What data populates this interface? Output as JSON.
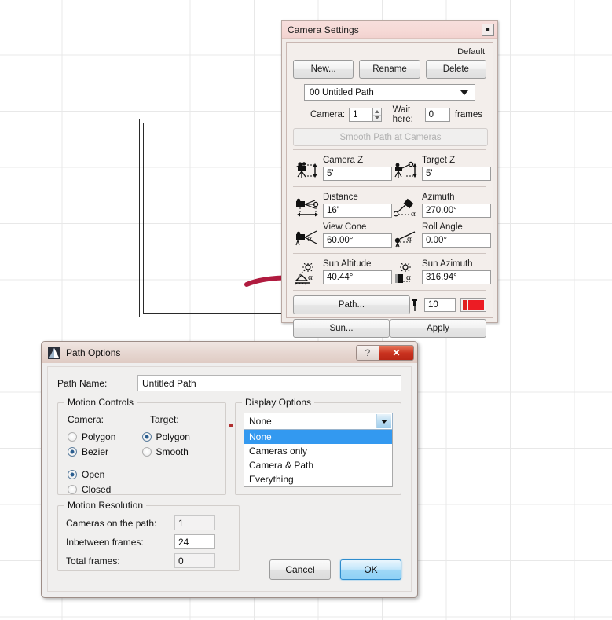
{
  "camera_settings": {
    "title": "Camera Settings",
    "close_icon": "close-icon",
    "default_label": "Default",
    "buttons": {
      "new": "New...",
      "rename": "Rename",
      "delete": "Delete"
    },
    "path_combo_value": "00  Untitled Path",
    "camera_label": "Camera:",
    "camera_value": "1",
    "wait_label": "Wait here:",
    "wait_value": "0",
    "frames_label": "frames",
    "smooth_button": "Smooth Path at Cameras",
    "fields": [
      {
        "label": "Camera Z",
        "value": "5'",
        "icon": "camera-height-icon"
      },
      {
        "label": "Target Z",
        "value": "5'",
        "icon": "target-height-icon"
      },
      {
        "label": "Distance",
        "value": "16'",
        "icon": "camera-distance-icon"
      },
      {
        "label": "Azimuth",
        "value": "270.00°",
        "icon": "azimuth-icon"
      },
      {
        "label": "View Cone",
        "value": "60.00°",
        "icon": "view-cone-icon"
      },
      {
        "label": "Roll Angle",
        "value": "0.00°",
        "icon": "roll-angle-icon"
      },
      {
        "label": "Sun Altitude",
        "value": "40.44°",
        "icon": "sun-altitude-icon"
      },
      {
        "label": "Sun Azimuth",
        "value": "316.94°",
        "icon": "sun-azimuth-icon"
      }
    ],
    "path_button": "Path...",
    "sun_button": "Sun...",
    "apply_button": "Apply",
    "speed_value": "10",
    "speed_icon": "pin-icon",
    "color_swatch_icon": "color-swatch-icon",
    "color_swatch_hex": "#ec1c24",
    "titlebar_hex": "#f6d9d6"
  },
  "path_options": {
    "title": "Path Options",
    "app_icon": "app-icon",
    "help_icon": "?",
    "close_icon": "✕",
    "path_name_label": "Path Name:",
    "path_name_value": "Untitled Path",
    "motion_controls": {
      "title": "Motion Controls",
      "camera_head": "Camera:",
      "target_head": "Target:",
      "camera_options": [
        {
          "label": "Polygon",
          "checked": false
        },
        {
          "label": "Bezier",
          "checked": true
        }
      ],
      "target_options": [
        {
          "label": "Polygon",
          "checked": true
        },
        {
          "label": "Smooth",
          "checked": false
        }
      ],
      "shape_options": [
        {
          "label": "Open",
          "checked": true
        },
        {
          "label": "Closed",
          "checked": false
        }
      ]
    },
    "display_options": {
      "title": "Display Options",
      "selected": "None",
      "items": [
        {
          "label": "None",
          "selected": true
        },
        {
          "label": "Cameras only",
          "selected": false
        },
        {
          "label": "Camera & Path",
          "selected": false
        },
        {
          "label": "Everything",
          "selected": false
        }
      ],
      "highlight_hex": "#3399f0"
    },
    "motion_resolution": {
      "title": "Motion Resolution",
      "rows": [
        {
          "label": "Cameras on the path:",
          "value": "1",
          "editable": false
        },
        {
          "label": "Inbetween frames:",
          "value": "24",
          "editable": true
        },
        {
          "label": "Total frames:",
          "value": "0",
          "editable": false
        }
      ]
    },
    "cancel_button": "Cancel",
    "ok_button": "OK",
    "titlebar_hex": "#e6d6d0",
    "close_hex": "#c9321f"
  },
  "canvas": {
    "grid_icon": "cad-grid",
    "floorplan_icon": "floorplan-rectangle",
    "annotation_arrow_icon": "red-arrow-annotation",
    "annotation_ellipse_icon": "red-ellipse-annotation",
    "annotation_hex": "#b01b3f"
  }
}
